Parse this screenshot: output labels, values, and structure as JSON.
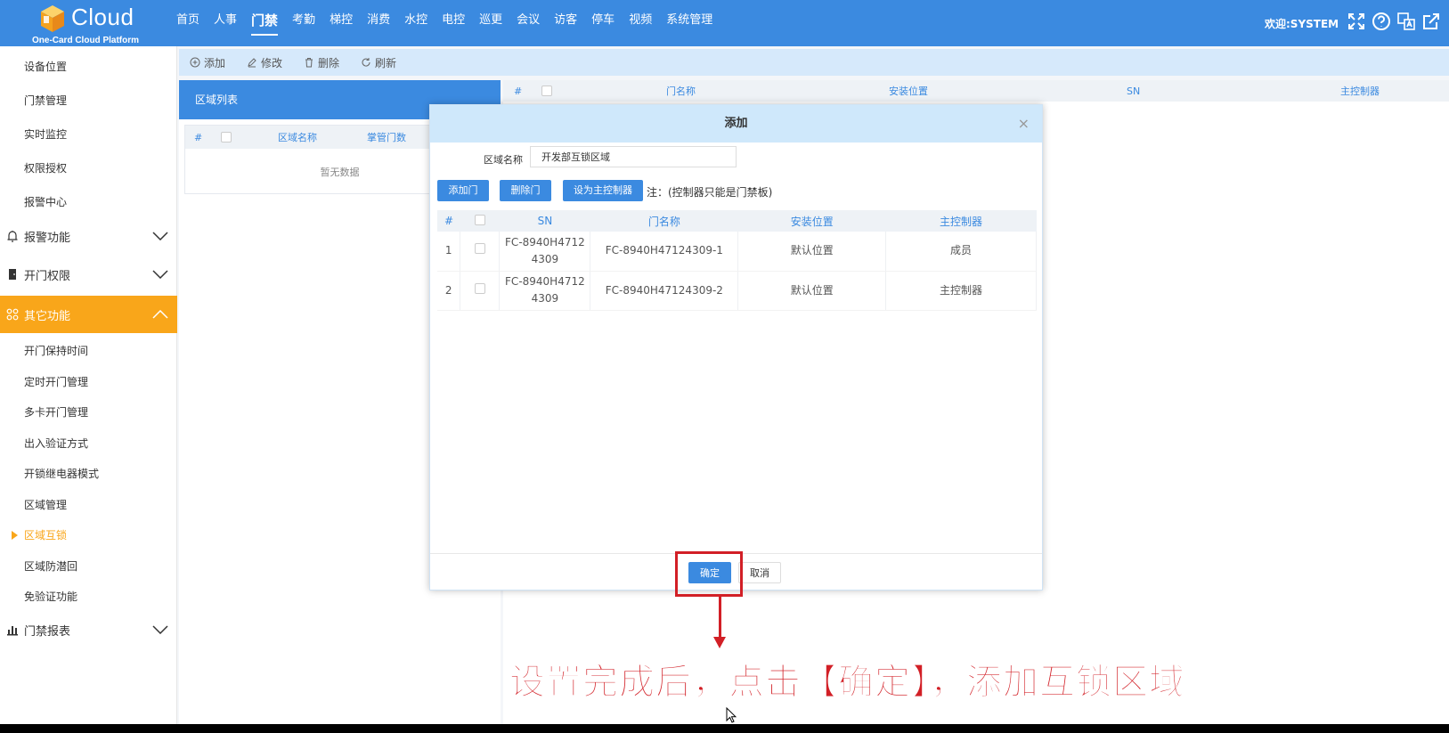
{
  "header": {
    "logo_word": "Cloud",
    "logo_subtitle": "One-Card Cloud Platform",
    "nav": [
      "首页",
      "人事",
      "门禁",
      "考勤",
      "梯控",
      "消费",
      "水控",
      "电控",
      "巡更",
      "会议",
      "访客",
      "停车",
      "视频",
      "系统管理"
    ],
    "active_nav_index": 2,
    "welcome": "欢迎:SYSTEM",
    "icons": [
      "fullscreen-icon",
      "help-icon",
      "translate-icon",
      "external-link-icon"
    ]
  },
  "sidebar": {
    "top_items": [
      "设备位置",
      "门禁管理",
      "实时监控",
      "权限授权",
      "报警中心"
    ],
    "groups": {
      "alarm": "报警功能",
      "door_permission": "开门权限",
      "other": "其它功能",
      "report": "门禁报表"
    },
    "other_items": [
      "开门保持时间",
      "定时开门管理",
      "多卡开门管理",
      "出入验证方式",
      "开锁继电器模式",
      "区域管理",
      "区域互锁",
      "区域防潜回",
      "免验证功能"
    ],
    "current_item": "区域互锁"
  },
  "toolbar": {
    "add": "添加",
    "edit": "修改",
    "delete": "删除",
    "refresh": "刷新"
  },
  "region_panel": {
    "title": "区域列表",
    "columns": [
      "#",
      "区域名称",
      "掌管门数"
    ],
    "empty_text": "暂无数据"
  },
  "main_table": {
    "columns": [
      "#",
      "门名称",
      "安装位置",
      "SN",
      "主控制器"
    ]
  },
  "modal": {
    "title": "添加",
    "close": "×",
    "region_name_label": "区域名称",
    "region_name_value": "开发部互锁区域",
    "btn_add_door": "添加门",
    "btn_delete_door": "删除门",
    "btn_set_master": "设为主控制器",
    "note": "注：(控制器只能是门禁板)",
    "columns": [
      "#",
      "SN",
      "门名称",
      "安装位置",
      "主控制器"
    ],
    "rows": [
      {
        "index": "1",
        "sn_line1": "FC-8940H4712",
        "sn_line2": "4309",
        "door_name": "FC-8940H47124309-1",
        "location": "默认位置",
        "controller": "成员"
      },
      {
        "index": "2",
        "sn_line1": "FC-8940H4712",
        "sn_line2": "4309",
        "door_name": "FC-8940H47124309-2",
        "location": "默认位置",
        "controller": "主控制器"
      }
    ],
    "ok": "确定",
    "cancel": "取消"
  },
  "annotation": {
    "caption": "设置完成后，点击【确定】，添加互锁区域",
    "color": "#d21f26"
  },
  "colors": {
    "primary": "#3b8ae0",
    "accent": "#f9a61a"
  }
}
